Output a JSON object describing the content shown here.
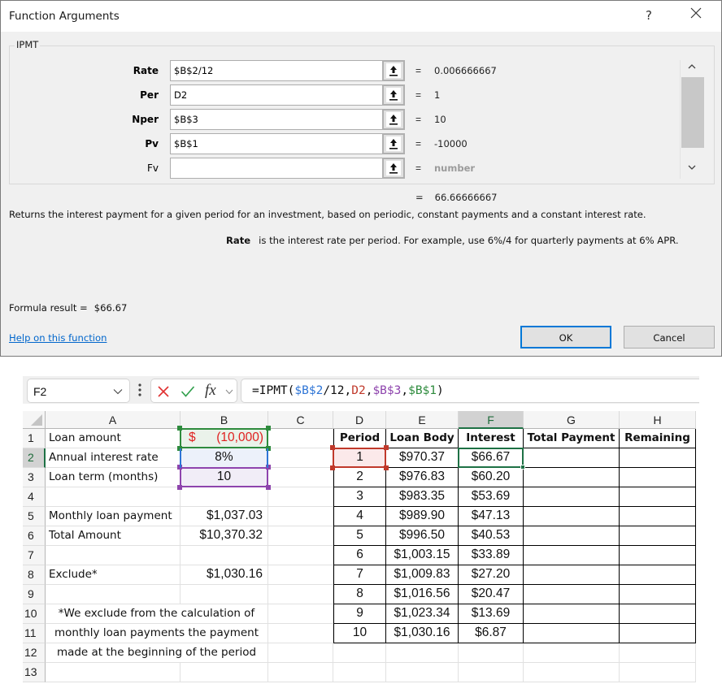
{
  "dialog": {
    "title": "Function Arguments",
    "help_button": "?",
    "function_name": "IPMT",
    "arguments": [
      {
        "label": "Rate",
        "value": "$B$2/12",
        "result": "0.006666667",
        "required": true
      },
      {
        "label": "Per",
        "value": "D2",
        "result": "1",
        "required": true
      },
      {
        "label": "Nper",
        "value": "$B$3",
        "result": "10",
        "required": true
      },
      {
        "label": "Pv",
        "value": "$B$1",
        "result": "-10000",
        "required": true
      },
      {
        "label": "Fv",
        "value": "",
        "result": "number",
        "required": false
      }
    ],
    "equals": "=",
    "function_result": "66.66666667",
    "description": "Returns the interest payment for a given period for an investment, based on periodic, constant payments and a constant interest rate.",
    "arg_description": {
      "name": "Rate",
      "text": "is the interest rate per period. For example, use 6%/4 for quarterly payments at 6% APR."
    },
    "formula_result_label": "Formula result =",
    "formula_result_value": "$66.67",
    "help_link": "Help on this function",
    "ok_label": "OK",
    "cancel_label": "Cancel"
  },
  "formula_bar": {
    "name_box": "F2",
    "fx_label": "fx",
    "formula_parts": [
      {
        "text": "=IPMT(",
        "color": "default"
      },
      {
        "text": "$B$2",
        "color": "blue"
      },
      {
        "text": "/12,",
        "color": "default"
      },
      {
        "text": "D2",
        "color": "red"
      },
      {
        "text": ",",
        "color": "default"
      },
      {
        "text": "$B$3",
        "color": "purple"
      },
      {
        "text": ",",
        "color": "default"
      },
      {
        "text": "$B$1",
        "color": "green"
      },
      {
        "text": ")",
        "color": "default"
      }
    ]
  },
  "sheet": {
    "columns": [
      "A",
      "B",
      "C",
      "D",
      "E",
      "F",
      "G",
      "H"
    ],
    "selected_column": "F",
    "rows": [
      "1",
      "2",
      "3",
      "4",
      "5",
      "6",
      "7",
      "8",
      "9",
      "10",
      "11",
      "12",
      "13"
    ],
    "selected_row": "2",
    "left_block": [
      {
        "row": 1,
        "label": "Loan amount",
        "value_symbol": "$",
        "value": "(10,000)"
      },
      {
        "row": 2,
        "label": "Annual interest rate",
        "value": "8%"
      },
      {
        "row": 3,
        "label": "Loan term (months)",
        "value": "10"
      },
      {
        "row": 5,
        "label": "Monthly loan payment",
        "value": "$1,037.03"
      },
      {
        "row": 6,
        "label": "Total Amount",
        "value": "$10,370.32"
      },
      {
        "row": 8,
        "label": "Exclude*",
        "value": "$1,030.16"
      }
    ],
    "note_lines": [
      "*We exclude from the calculation of",
      "monthly loan payments the payment",
      "made at the beginning of the period"
    ],
    "table": {
      "headers": [
        "Period",
        "Loan Body",
        "Interest",
        "Total Payment",
        "Remaining"
      ],
      "rows": [
        [
          "1",
          "$970.37",
          "$66.67",
          "",
          ""
        ],
        [
          "2",
          "$976.83",
          "$60.20",
          "",
          ""
        ],
        [
          "3",
          "$983.35",
          "$53.69",
          "",
          ""
        ],
        [
          "4",
          "$989.90",
          "$47.13",
          "",
          ""
        ],
        [
          "5",
          "$996.50",
          "$40.53",
          "",
          ""
        ],
        [
          "6",
          "$1,003.15",
          "$33.89",
          "",
          ""
        ],
        [
          "7",
          "$1,009.83",
          "$27.20",
          "",
          ""
        ],
        [
          "8",
          "$1,016.56",
          "$20.47",
          "",
          ""
        ],
        [
          "9",
          "$1,023.34",
          "$13.69",
          "",
          ""
        ],
        [
          "10",
          "$1,030.16",
          "$6.87",
          "",
          ""
        ]
      ]
    }
  },
  "colors": {
    "ref_blue": "#2e75d6",
    "ref_red": "#c0392b",
    "ref_purple": "#8e44ad",
    "ref_green": "#2e8b3d",
    "selection_green": "#1e7145",
    "negative_red": "#e02020",
    "dialog_ok_border": "#0078d7",
    "link": "#0066cc"
  }
}
